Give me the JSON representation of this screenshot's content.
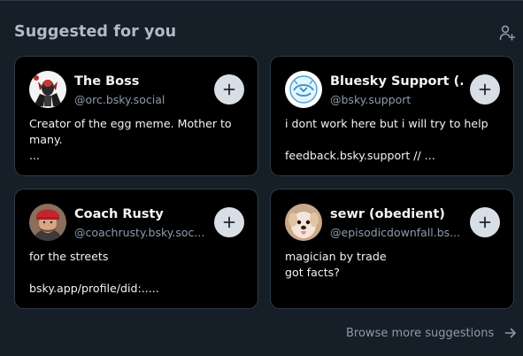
{
  "section": {
    "title": "Suggested for you",
    "browse_label": "Browse more suggestions"
  },
  "colors": {
    "background": "#161e27",
    "card_background": "#000000",
    "card_border": "#2e3a48",
    "muted_text": "#8d9bab",
    "follow_button": "#d8dee6"
  },
  "suggestions": [
    {
      "name": "The Boss",
      "handle": "@orc.bsky.social",
      "bio": [
        "Creator of the egg meme. Mother to",
        "many.",
        "..."
      ],
      "avatar_icon": "boss-avatar"
    },
    {
      "name": "Bluesky Support (...",
      "handle": "@bsky.support",
      "bio": [
        "i dont work here but i will try to help",
        "",
        "feedback.bsky.support // ..."
      ],
      "avatar_icon": "bluesky-support-avatar"
    },
    {
      "name": "Coach Rusty",
      "handle": "@coachrusty.bsky.soc...",
      "bio": [
        "for the streets",
        "",
        "bsky.app/profile/did:....."
      ],
      "avatar_icon": "coach-rusty-avatar"
    },
    {
      "name": "sewr (obedient)",
      "handle": "@episodicdownfall.bs...",
      "bio": [
        "magician by trade",
        "got facts?"
      ],
      "avatar_icon": "puppy-avatar"
    }
  ]
}
